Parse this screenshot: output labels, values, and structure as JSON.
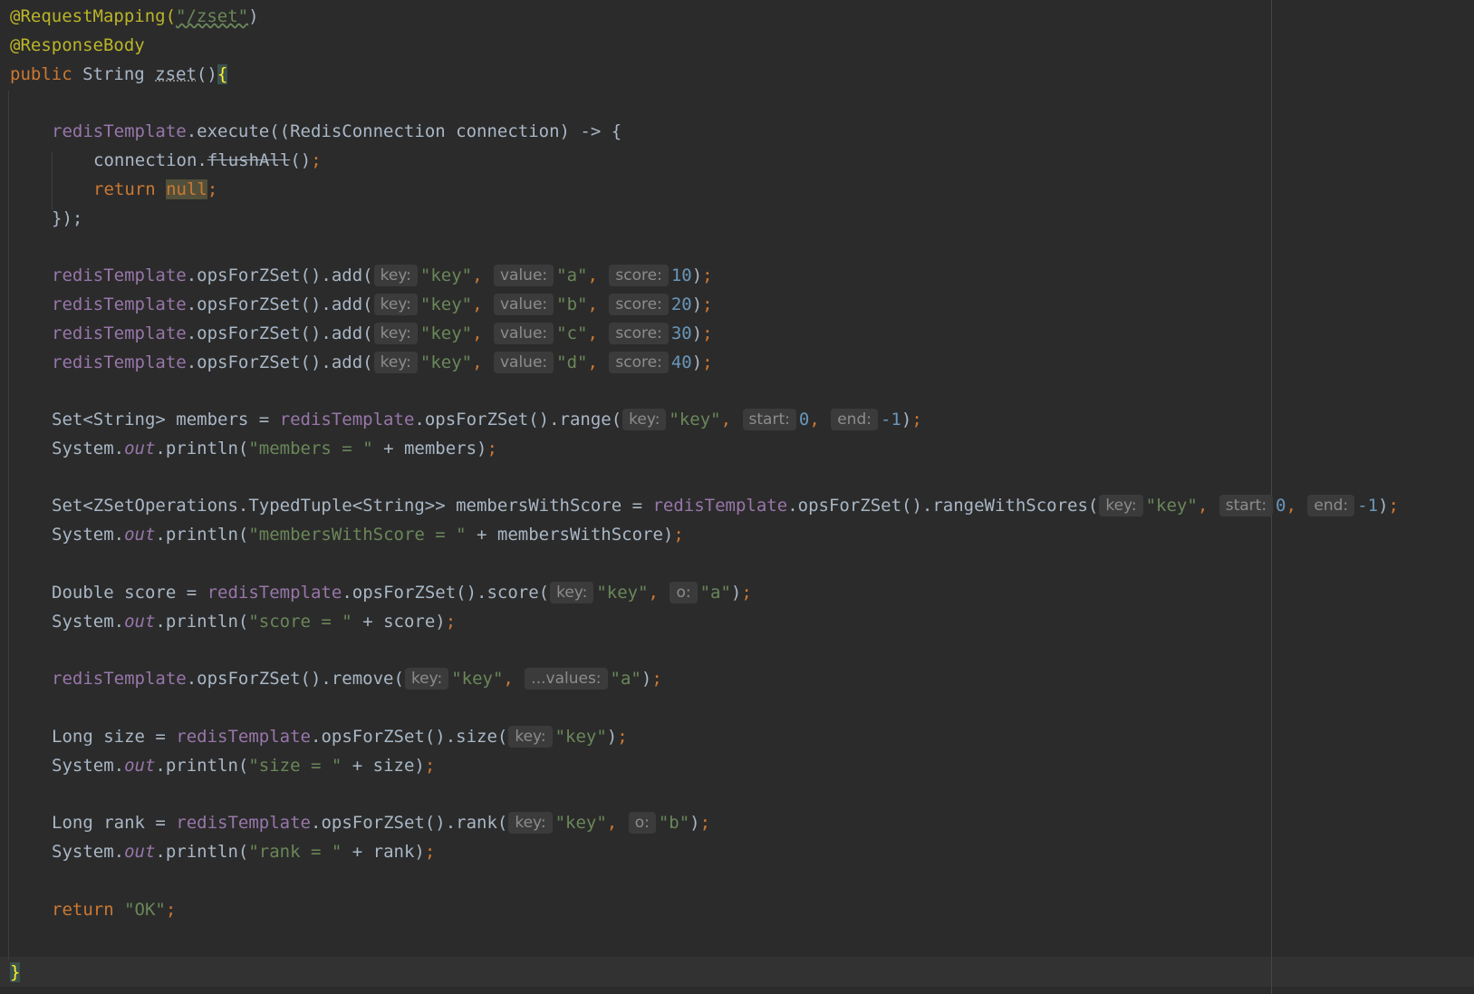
{
  "code": {
    "l1_annotation": "@RequestMapping(",
    "l1_path": "\"/zset\"",
    "l1_close": ")",
    "l2_annotation": "@ResponseBody",
    "l3_public": "public",
    "l3_type": " String ",
    "l3_method": "zset",
    "l3_parens": "()",
    "l3_brace": "{",
    "l5_field": "redisTemplate",
    "l5_rest": ".execute((RedisConnection connection) -> {",
    "l6_pre": "connection.",
    "l6_deprecated": "flushAll",
    "l6_post": "()",
    "l7_return": "return",
    "l7_null": "null",
    "l8": "});",
    "add_method": ".opsForZSet().add(",
    "hint_key": "key:",
    "hint_value": "value:",
    "hint_score": "score:",
    "hint_start": "start:",
    "hint_end": "end:",
    "hint_o": "o:",
    "hint_values": "...values:",
    "key_str": "\"key\"",
    "add_rows": [
      {
        "value": "\"a\"",
        "score": "10"
      },
      {
        "value": "\"b\"",
        "score": "20"
      },
      {
        "value": "\"c\"",
        "score": "30"
      },
      {
        "value": "\"d\"",
        "score": "40"
      }
    ],
    "members_decl": "Set<String> members = ",
    "range_call": ".opsForZSet().range(",
    "zero": "0",
    "minus_one": "-1",
    "sysout_pre": "System.",
    "sysout_out": "out",
    "sysout_println": ".println(",
    "members_label": "\"members = \"",
    "members_var": " + members)",
    "mws_decl": "Set<ZSetOperations.TypedTuple<String>> membersWithScore = ",
    "rws_call": ".opsForZSet().rangeWithScores(",
    "mws_label": "\"membersWithScore = \"",
    "mws_var": " + membersWithScore)",
    "score_decl": "Double score = ",
    "score_call": ".opsForZSet().score(",
    "score_label": "\"score = \"",
    "score_var": " + score)",
    "remove_call": ".opsForZSet().remove(",
    "size_decl": "Long size = ",
    "size_call": ".opsForZSet().size(",
    "size_label": "\"size = \"",
    "size_var": " + size)",
    "rank_decl": "Long rank = ",
    "rank_call": ".opsForZSet().rank(",
    "rank_label": "\"rank = \"",
    "rank_var": " + rank)",
    "b_str": "\"b\"",
    "a_str": "\"a\"",
    "return_kw": "return",
    "ok_str": "\"OK\"",
    "closing_brace": "}",
    "comma": ",",
    "semicolon": ";",
    "close_paren": ")"
  }
}
